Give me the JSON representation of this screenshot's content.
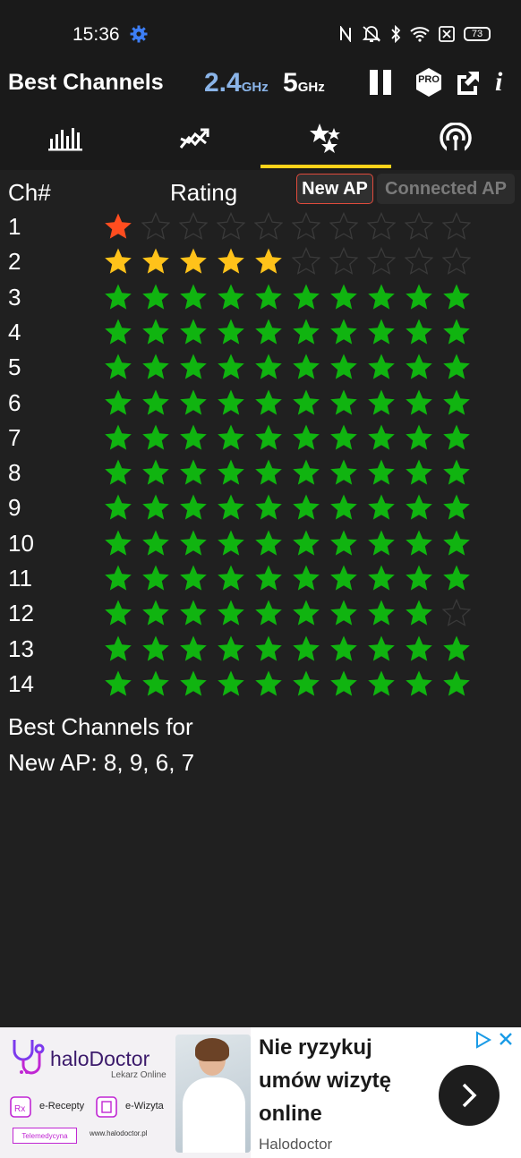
{
  "status_bar": {
    "time": "15:36",
    "battery": "73"
  },
  "app_bar": {
    "title": "Best Channels",
    "band_24": "2.4",
    "band_5": "5",
    "ghz_unit": "GHz",
    "pro_label": "PRO",
    "info_label": "i"
  },
  "tabs": [
    {
      "icon": "bar-chart-icon"
    },
    {
      "icon": "trend-icon"
    },
    {
      "icon": "stars-icon",
      "selected": true
    },
    {
      "icon": "signal-icon"
    }
  ],
  "table": {
    "col_channel": "Ch#",
    "col_rating": "Rating",
    "new_ap_label": "New AP",
    "connected_ap_label": "Connected AP",
    "max_stars": 10,
    "colors": {
      "red": "#ff4d1f",
      "yellow": "#ffc21a",
      "green": "#10b410",
      "empty": "#3a3a3a"
    },
    "rows": [
      {
        "ch": "1",
        "rating": 1,
        "color": "red"
      },
      {
        "ch": "2",
        "rating": 5,
        "color": "yellow"
      },
      {
        "ch": "3",
        "rating": 10,
        "color": "green"
      },
      {
        "ch": "4",
        "rating": 10,
        "color": "green"
      },
      {
        "ch": "5",
        "rating": 10,
        "color": "green"
      },
      {
        "ch": "6",
        "rating": 10,
        "color": "green"
      },
      {
        "ch": "7",
        "rating": 10,
        "color": "green"
      },
      {
        "ch": "8",
        "rating": 10,
        "color": "green"
      },
      {
        "ch": "9",
        "rating": 10,
        "color": "green"
      },
      {
        "ch": "10",
        "rating": 10,
        "color": "green"
      },
      {
        "ch": "11",
        "rating": 10,
        "color": "green"
      },
      {
        "ch": "12",
        "rating": 9,
        "color": "green"
      },
      {
        "ch": "13",
        "rating": 10,
        "color": "green"
      },
      {
        "ch": "14",
        "rating": 10,
        "color": "green"
      }
    ]
  },
  "summary": {
    "line1": "Best Channels for",
    "line2": "New AP: 8, 9, 6, 7"
  },
  "ad": {
    "logo_text": "haloDoctor",
    "logo_sub": "Lekarz Online",
    "item1": "e-Recepty",
    "item2": "e-Wizyta",
    "badge": "Telemedycyna",
    "url": "www.halodoctor.pl",
    "headline": "Nie ryzykuj umów wizytę online",
    "brand": "Halodoctor"
  }
}
